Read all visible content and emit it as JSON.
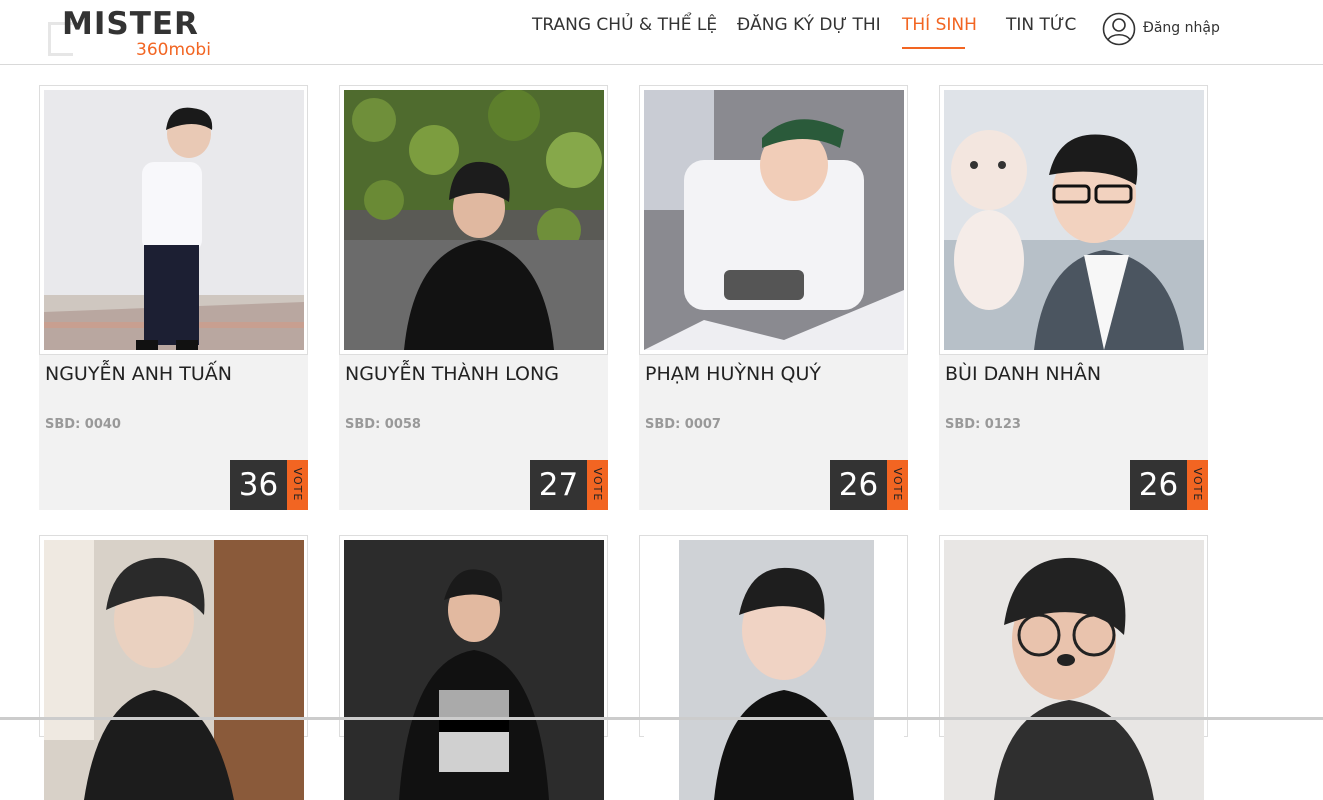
{
  "logo": {
    "title": "MISTER",
    "subtitle": "360mobi"
  },
  "nav": {
    "items": [
      {
        "label": "TRANG CHỦ & THỂ LỆ"
      },
      {
        "label": "ĐĂNG KÝ DỰ THI"
      },
      {
        "label": "THÍ SINH",
        "active": true
      },
      {
        "label": "TIN TỨC"
      }
    ],
    "login_label": "Đăng nhập"
  },
  "contestants": [
    {
      "name": "NGUYỄN ANH TUẤN",
      "sbd": "SBD: 0040",
      "votes": "36",
      "vote_label": "VOTE"
    },
    {
      "name": "NGUYỄN THÀNH LONG",
      "sbd": "SBD: 0058",
      "votes": "27",
      "vote_label": "VOTE"
    },
    {
      "name": "PHẠM HUỲNH QUÝ",
      "sbd": "SBD: 0007",
      "votes": "26",
      "vote_label": "VOTE"
    },
    {
      "name": "BÙI DANH NHÂN",
      "sbd": "SBD: 0123",
      "votes": "26",
      "vote_label": "VOTE"
    }
  ],
  "colors": {
    "accent": "#f26522",
    "dark": "#333333",
    "card_bg": "#f2f2f2"
  },
  "icons": {
    "login": "user-circle-icon"
  }
}
